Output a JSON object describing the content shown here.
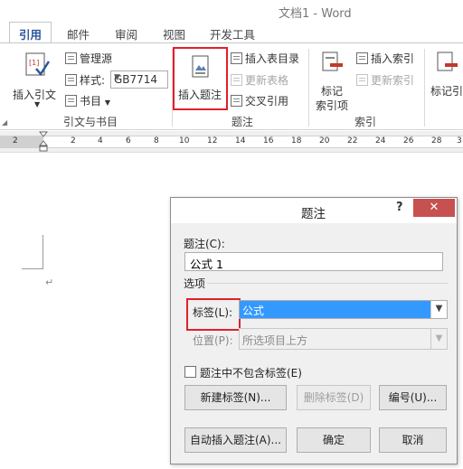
{
  "window": {
    "title": "文档1 - Word"
  },
  "tabs": [
    {
      "label": "引用",
      "active": true
    },
    {
      "label": "邮件"
    },
    {
      "label": "审阅"
    },
    {
      "label": "视图"
    },
    {
      "label": "开发工具"
    }
  ],
  "ribbon": {
    "citations": {
      "insert_citation": "插入引文",
      "manage_sources": "管理源",
      "style_label": "样式:",
      "style_value": "GB7714",
      "bibliography": "书目",
      "group_label": "引文与书目"
    },
    "captions": {
      "insert_caption": "插入题注",
      "insert_table_of_figures": "插入表目录",
      "update_table": "更新表格",
      "cross_reference": "交叉引用",
      "group_label": "题注"
    },
    "index": {
      "mark_entry_line1": "标记",
      "mark_entry_line2": "索引项",
      "insert_index": "插入索引",
      "update_index": "更新索引",
      "group_label": "索引"
    },
    "authorities": {
      "mark_citation": "标记引"
    }
  },
  "ruler": {
    "ticks": [
      "2",
      "2",
      "4",
      "6",
      "8",
      "10",
      "12",
      "14",
      "16",
      "18",
      "20",
      "22",
      "24",
      "26",
      "28",
      "3"
    ]
  },
  "document": {
    "paragraph_mark": "↵"
  },
  "dialog": {
    "title": "题注",
    "help": "?",
    "close": "✕",
    "caption_label": "题注(C):",
    "caption_value": "公式 1",
    "options_label": "选项",
    "label_label": "标签(L):",
    "label_value": "公式",
    "position_label": "位置(P):",
    "position_value": "所选项目上方",
    "exclude_label_text": "题注中不包含标签(E)",
    "new_label_button": "新建标签(N)...",
    "delete_label_button": "删除标签(D)",
    "numbering_button": "编号(U)...",
    "autocaption_button": "自动插入题注(A)...",
    "ok_button": "确定",
    "cancel_button": "取消"
  }
}
